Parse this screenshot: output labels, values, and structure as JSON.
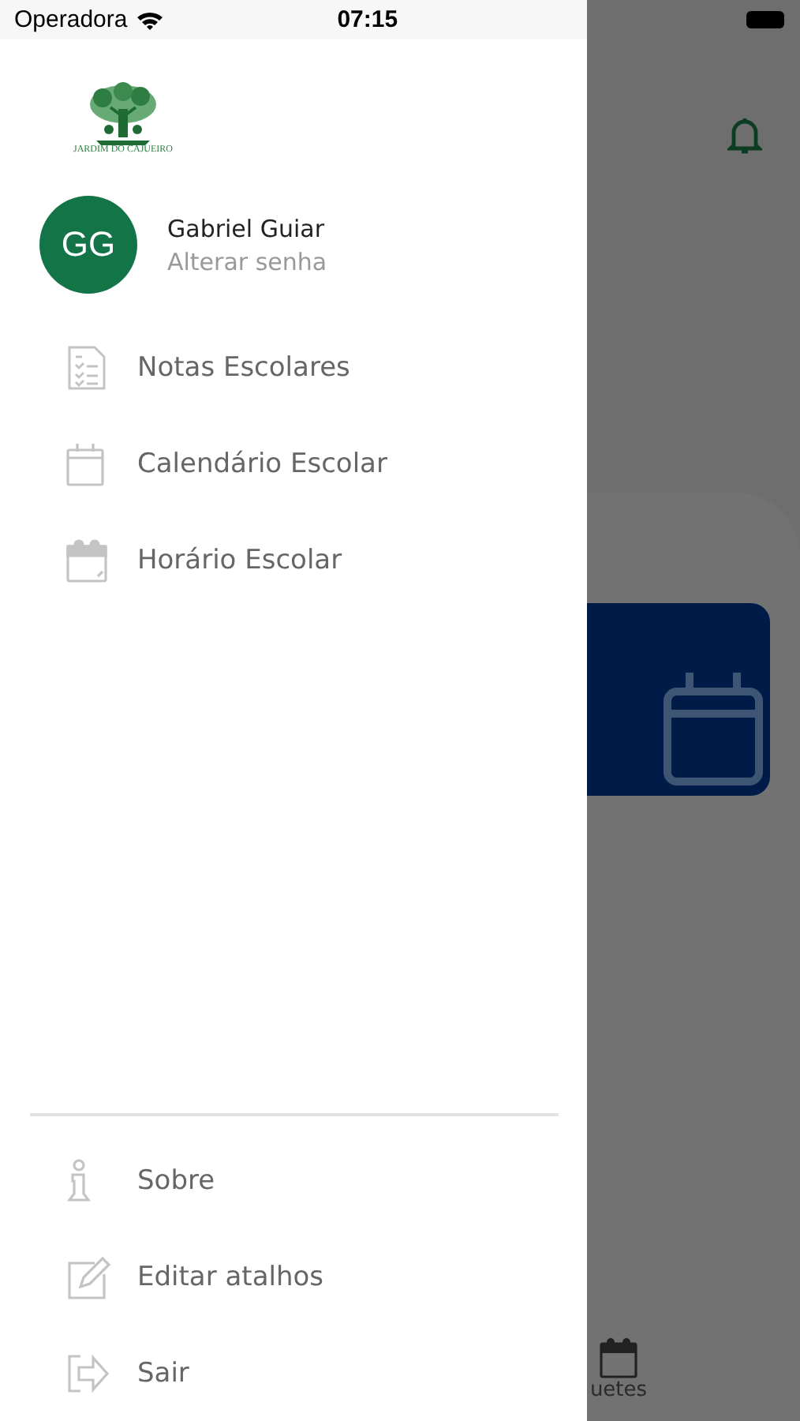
{
  "status_bar": {
    "carrier": "Operadora",
    "time": "07:15"
  },
  "logo": {
    "text": "JARDIM DO CAJUEIRO"
  },
  "user": {
    "initials": "GG",
    "name": "Gabriel Guiar",
    "action": "Alterar senha"
  },
  "menu": [
    {
      "label": "Notas Escolares",
      "kind": "grades"
    },
    {
      "label": "Calendário Escolar",
      "kind": "calendar"
    },
    {
      "label": "Horário Escolar",
      "kind": "schedule"
    }
  ],
  "footer_menu": [
    {
      "label": "Sobre",
      "kind": "info"
    },
    {
      "label": "Editar atalhos",
      "kind": "edit"
    },
    {
      "label": "Sair",
      "kind": "exit"
    }
  ],
  "background": {
    "tab_label": "uetes"
  }
}
